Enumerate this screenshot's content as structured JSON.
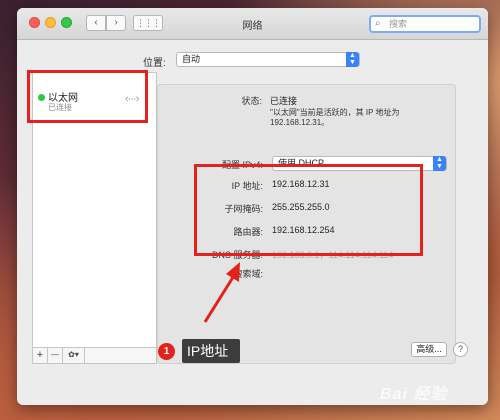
{
  "window": {
    "title": "网络",
    "search_placeholder": "搜索",
    "nav_back": "‹",
    "nav_forward": "›",
    "grid_icon": "⋮⋮⋮"
  },
  "location": {
    "label": "位置:",
    "value": "自动"
  },
  "sidebar": {
    "service_name": "以太网",
    "service_status": "已连接",
    "service_icon": "‹···›",
    "status_color": "#2ec940",
    "add": "+",
    "remove": "—",
    "gear": "✿▾"
  },
  "detail": {
    "status_label": "状态:",
    "status_value": "已连接",
    "status_desc_1": "\"以太网\"当前是活跃的，其 IP 地址为",
    "status_desc_2": "192.168.12.31。",
    "ipv4_label": "配置 IPv4:",
    "ipv4_value": "使用 DHCP",
    "ip_label": "IP 地址:",
    "ip_value": "192.168.12.31",
    "subnet_label": "子网掩码:",
    "subnet_value": "255.255.255.0",
    "router_label": "路由器:",
    "router_value": "192.168.12.254",
    "dns_label": "DNS 服务器:",
    "dns_value": "192.168.0.1，114.114.114.114",
    "search_domain_label": "搜索域:"
  },
  "buttons": {
    "advanced": "高级...",
    "help": "?"
  },
  "callout": {
    "number": "1",
    "text": "IP地址"
  },
  "accent_color": "#e3221c",
  "watermark": "Bai 经验"
}
